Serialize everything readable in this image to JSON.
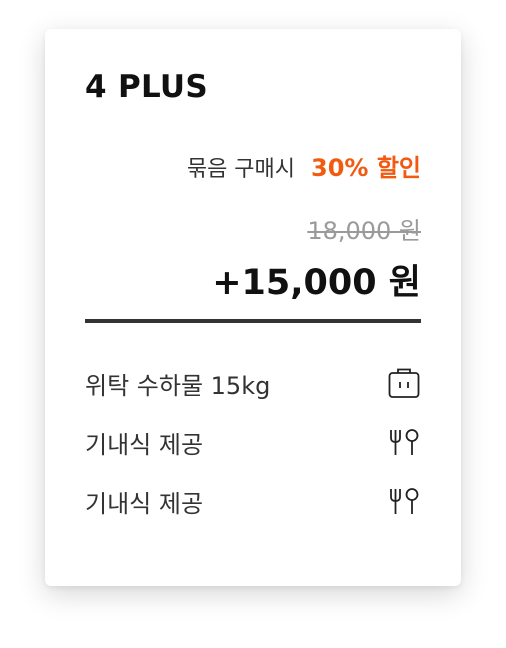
{
  "card": {
    "title": "4 PLUS",
    "bundle_text": "묶음 구매시",
    "discount_text": "30% 할인",
    "original_price": "18,000 원",
    "final_price": "+15,000 원",
    "accent_color": "#f15a0f"
  },
  "features": [
    {
      "label": "위탁 수하물 15kg",
      "icon": "luggage-icon"
    },
    {
      "label": "기내식 제공",
      "icon": "fork-spoon-icon"
    },
    {
      "label": "기내식 제공",
      "icon": "fork-spoon-icon"
    }
  ]
}
